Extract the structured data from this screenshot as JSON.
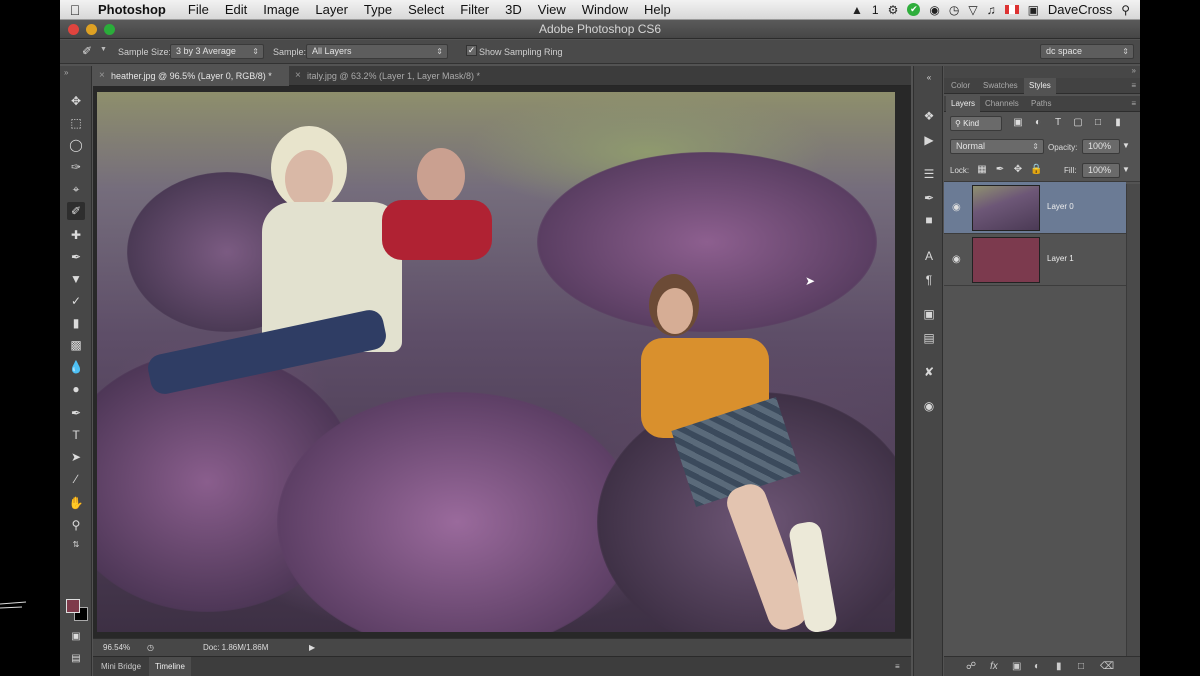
{
  "menubar": {
    "app_name": "Photoshop",
    "items": [
      "File",
      "Edit",
      "Image",
      "Layer",
      "Type",
      "Select",
      "Filter",
      "3D",
      "View",
      "Window",
      "Help"
    ],
    "status_number": "1",
    "user": "DaveCross"
  },
  "window": {
    "title": "Adobe Photoshop CS6"
  },
  "options": {
    "sample_size_label": "Sample Size:",
    "sample_size_value": "3 by 3 Average",
    "sample_label": "Sample:",
    "sample_value": "All Layers",
    "show_ring_label": "Show Sampling Ring",
    "workspace": "dc space"
  },
  "tabs": [
    {
      "label": "heather.jpg @ 96.5% (Layer 0, RGB/8) *",
      "active": true
    },
    {
      "label": "italy.jpg @ 63.2% (Layer 1, Layer Mask/8) *",
      "active": false
    }
  ],
  "status": {
    "zoom": "96.54%",
    "doc": "Doc: 1.86M/1.86M"
  },
  "bottom_tabs": [
    "Mini Bridge",
    "Timeline"
  ],
  "panels": {
    "top_tabs": [
      "Color",
      "Swatches",
      "Styles"
    ],
    "layer_tabs": [
      "Layers",
      "Channels",
      "Paths"
    ],
    "kind": "Kind",
    "blend_mode": "Normal",
    "opacity_label": "Opacity:",
    "opacity_value": "100%",
    "lock_label": "Lock:",
    "fill_label": "Fill:",
    "fill_value": "100%",
    "layers": [
      {
        "name": "Layer 0",
        "selected": true
      },
      {
        "name": "Layer 1",
        "selected": false
      }
    ]
  },
  "colors": {
    "foreground": "#7e3a4a",
    "background": "#000000",
    "layer1_fill": "#7c3a4e",
    "selection": "#6b7b95"
  }
}
